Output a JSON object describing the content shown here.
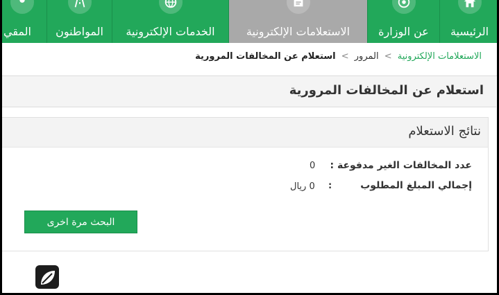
{
  "nav": {
    "items": [
      {
        "label": "الرئيسية",
        "icon": "home-icon"
      },
      {
        "label": "عن الوزارة",
        "icon": "emblem-icon"
      },
      {
        "label": "الاستعلامات الإلكترونية",
        "icon": "inquiry-icon",
        "active": true
      },
      {
        "label": "الخدمات الإلكترونية",
        "icon": "globe-icon"
      },
      {
        "label": "المواطنون",
        "icon": "road-icon"
      },
      {
        "label": "المقي",
        "icon": "residents-icon"
      }
    ]
  },
  "breadcrumb": {
    "home": "الاستعلامات الإلكترونية",
    "separator": ">",
    "section": "المرور",
    "current": "استعلام عن المخالفات المرورية"
  },
  "page": {
    "title": "استعلام عن المخالفات المرورية"
  },
  "results": {
    "title": "نتائج الاستعلام",
    "unpaid_label": "عدد المخالفات الغير مدفوعة :",
    "unpaid_value": "0",
    "total_label": "إجمالي المبلغ المطلوب",
    "total_colon": ":",
    "total_value": "0 ريال"
  },
  "actions": {
    "search_again": "البحث مرة اخرى"
  },
  "colors": {
    "primary": "#22a85a",
    "active_tab": "#a9a9a9"
  }
}
